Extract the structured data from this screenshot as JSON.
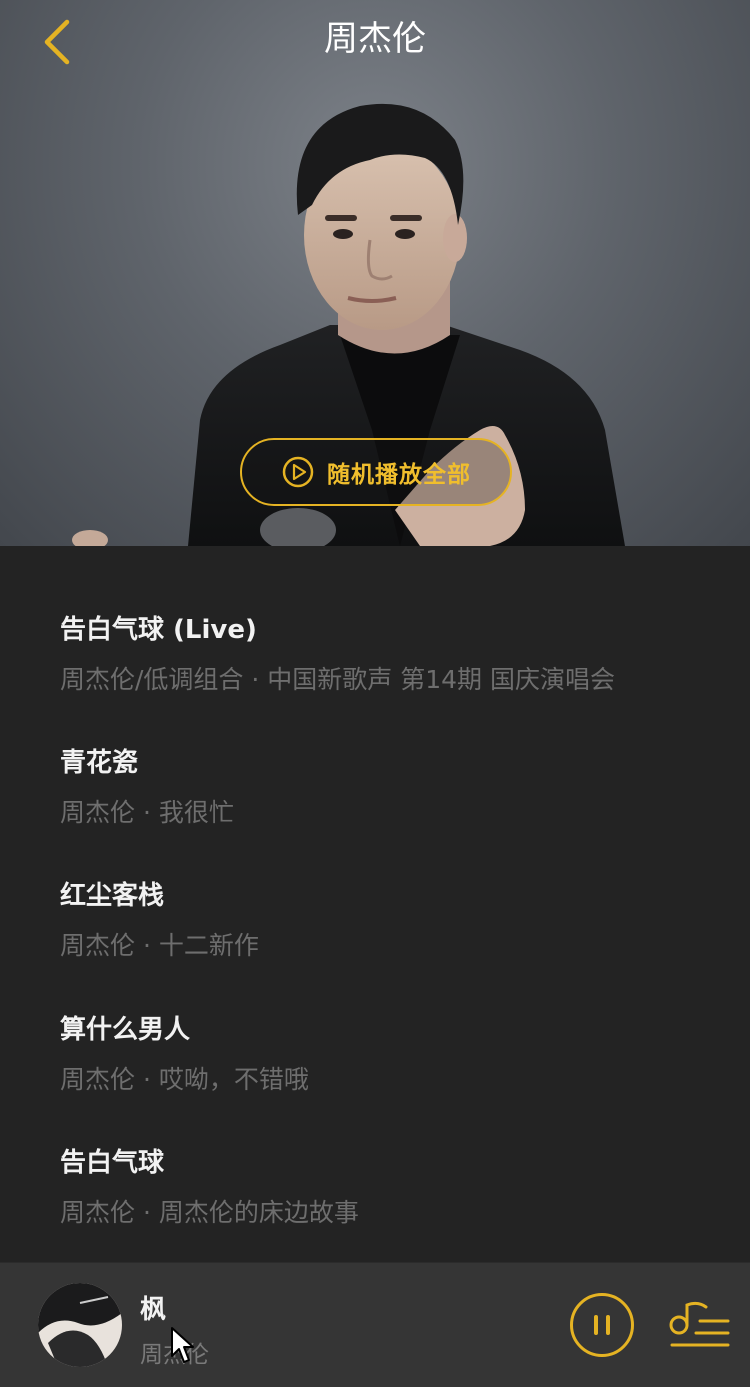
{
  "header": {
    "title": "周杰伦",
    "back_icon": "chevron-left-icon"
  },
  "hero": {
    "shuffle_label": "随机播放全部",
    "shuffle_icon": "play-circle-icon"
  },
  "songs": [
    {
      "title": "告白气球 (Live)",
      "subtitle": "周杰伦/低调组合 · 中国新歌声 第14期 国庆演唱会"
    },
    {
      "title": "青花瓷",
      "subtitle": "周杰伦 · 我很忙"
    },
    {
      "title": "红尘客栈",
      "subtitle": "周杰伦 · 十二新作"
    },
    {
      "title": "算什么男人",
      "subtitle": "周杰伦 · 哎呦，不错哦"
    },
    {
      "title": "告白气球",
      "subtitle": "周杰伦 · 周杰伦的床边故事"
    }
  ],
  "player": {
    "title": "枫",
    "artist": "周杰伦",
    "pause_icon": "pause-icon",
    "queue_icon": "playlist-icon"
  },
  "colors": {
    "accent": "#e5b323",
    "list_background": "#232323",
    "player_background": "#353535",
    "subtitle_text": "#6e6e6e"
  }
}
